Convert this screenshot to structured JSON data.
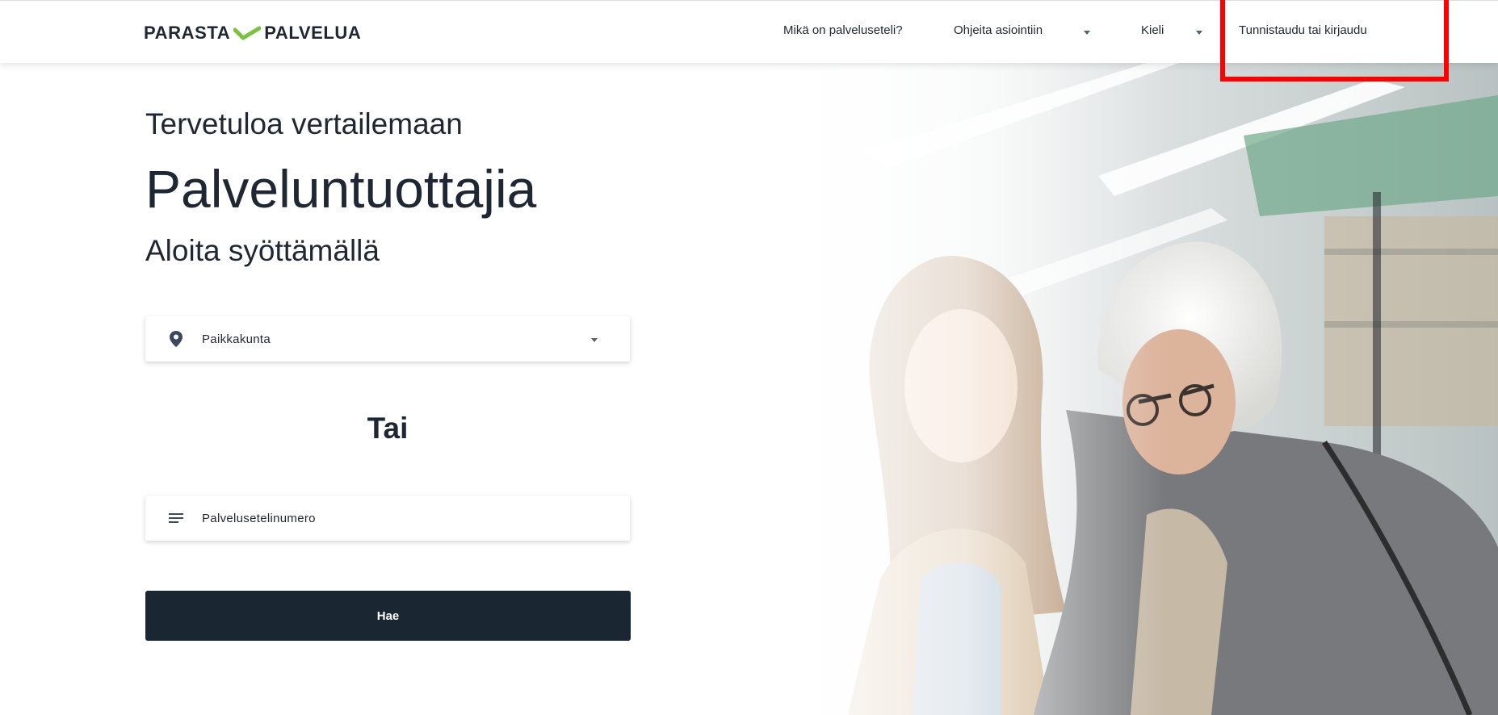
{
  "header": {
    "logo": {
      "left": "PARASTA",
      "right": "PALVELUA"
    },
    "nav": {
      "what_is_voucher": "Mikä on palveluseteli?",
      "instructions": "Ohjeita asiointiin",
      "language": "Kieli",
      "login": "Tunnistaudu tai kirjaudu"
    }
  },
  "main": {
    "welcome": "Tervetuloa vertailemaan",
    "headline": "Palveluntuottajia",
    "subheadline": "Aloita syöttämällä",
    "municipality_field": {
      "label": "Paikkakunta"
    },
    "or_label": "Tai",
    "voucher_field": {
      "label": "Palvelusetelinumero"
    },
    "search_button": "Hae"
  },
  "icons": {
    "municipality": "map-pin-icon",
    "voucher": "lines-icon",
    "logo_mark": "check-swoosh-icon",
    "caret": "caret-down-icon"
  },
  "colors": {
    "text": "#1f2733",
    "button": "#1b2633",
    "logo_accent": "#7cc242",
    "highlight": "#ff0000"
  }
}
